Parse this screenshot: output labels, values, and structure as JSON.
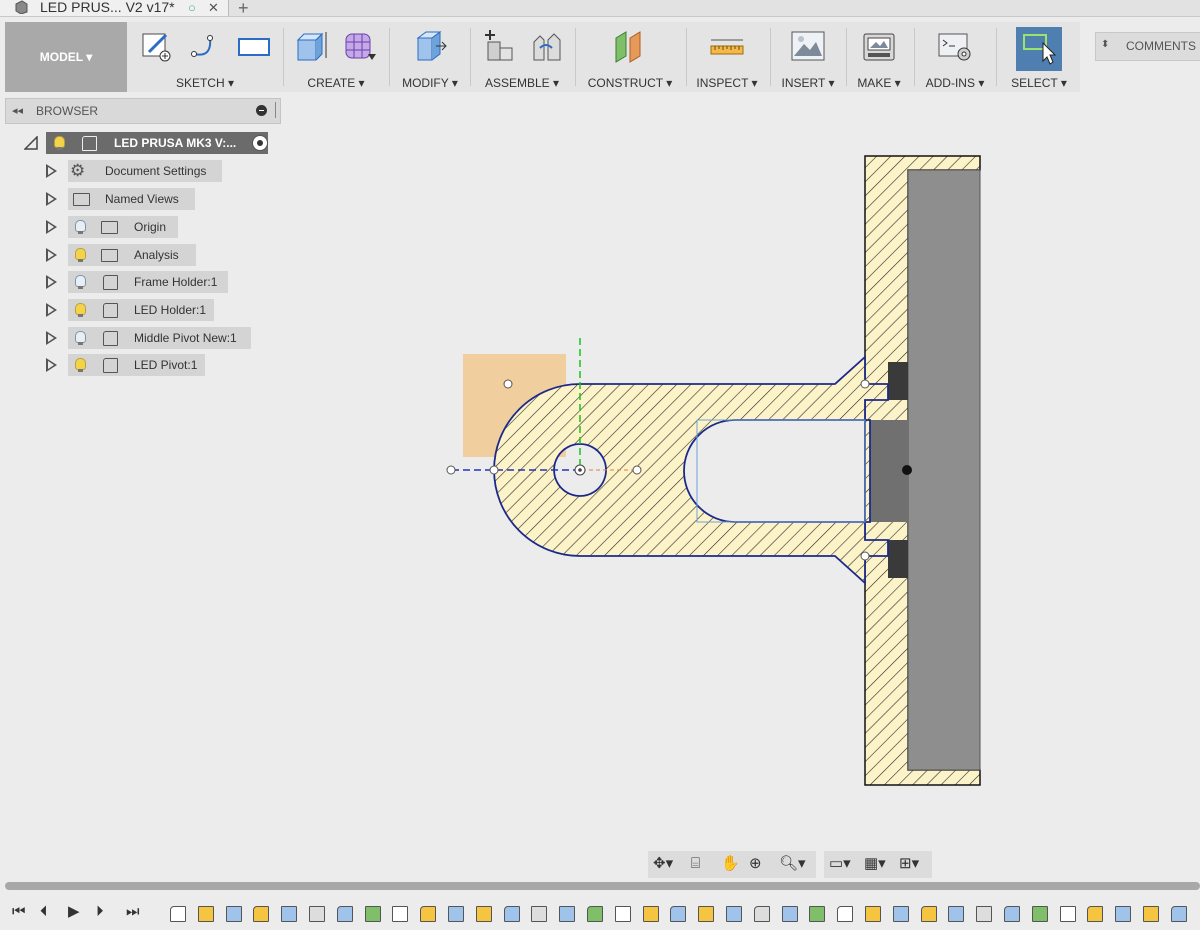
{
  "tab": {
    "title": "LED PRUS... V2 v17*",
    "status_icon": "circle-icon",
    "close_icon": "close-icon",
    "new_tab_icon": "plus-icon"
  },
  "toolbar": {
    "workspace": "MODEL",
    "groups": [
      {
        "label": "SKETCH",
        "icons": [
          "create-sketch-icon",
          "arc-icon",
          "rectangle-icon"
        ]
      },
      {
        "label": "CREATE",
        "icons": [
          "extrude-icon",
          "form-icon"
        ]
      },
      {
        "label": "MODIFY",
        "icons": [
          "press-pull-icon"
        ]
      },
      {
        "label": "ASSEMBLE",
        "icons": [
          "new-component-icon",
          "joint-icon"
        ]
      },
      {
        "label": "CONSTRUCT",
        "icons": [
          "plane-icon"
        ]
      },
      {
        "label": "INSPECT",
        "icons": [
          "measure-icon"
        ]
      },
      {
        "label": "INSERT",
        "icons": [
          "image-icon"
        ]
      },
      {
        "label": "MAKE",
        "icons": [
          "print-icon"
        ]
      },
      {
        "label": "ADD-INS",
        "icons": [
          "scripts-icon"
        ]
      },
      {
        "label": "SELECT",
        "icons": [
          "select-icon"
        ]
      }
    ],
    "caret": "▾",
    "comments": "COMMENTS"
  },
  "browser": {
    "title": "BROWSER",
    "root": "LED PRUSA MK3 V:...",
    "items": [
      {
        "label": "Document Settings",
        "icon": "gear-icon"
      },
      {
        "label": "Named Views",
        "icon": "folder-icon"
      },
      {
        "label": "Origin",
        "icon": "folder-icon",
        "bulb": "off"
      },
      {
        "label": "Analysis",
        "icon": "folder-icon",
        "bulb": "on"
      },
      {
        "label": "Frame Holder:1",
        "icon": "body-icon",
        "bulb": "off"
      },
      {
        "label": "LED Holder:1",
        "icon": "body-icon",
        "bulb": "on"
      },
      {
        "label": "Middle Pivot New:1",
        "icon": "body-icon",
        "bulb": "off"
      },
      {
        "label": "LED Pivot:1",
        "icon": "body-icon",
        "bulb": "on"
      }
    ]
  },
  "colors": {
    "hatch_fill": "#fdf3c8",
    "hatch_line": "#2a2a2a",
    "profile": "#1b2a8a",
    "steel": "#8e8e8e",
    "select_blue": "#4e7fb0",
    "sketch_orange": "#f5b65c"
  }
}
